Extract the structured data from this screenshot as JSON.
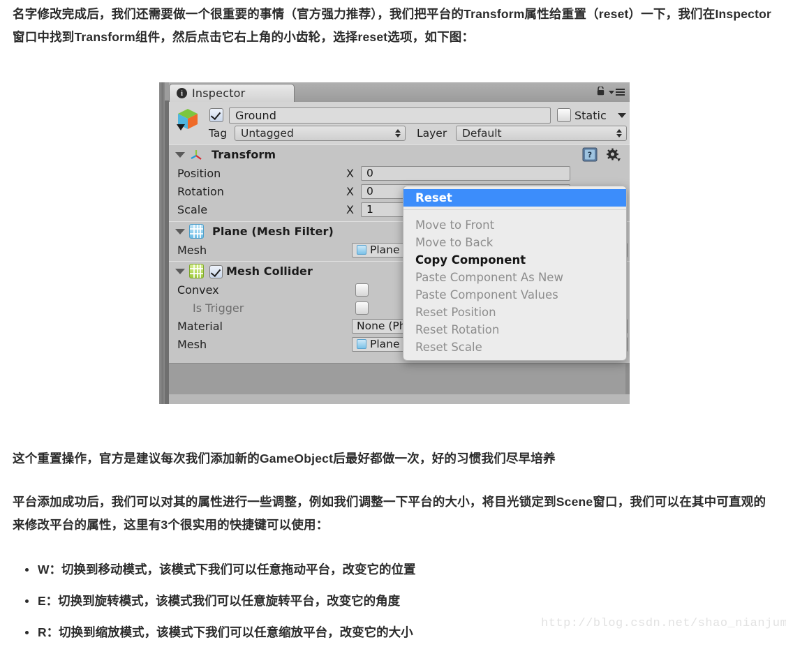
{
  "article": {
    "paragraph_1": "名字修改完成后，我们还需要做一个很重要的事情（官方强力推荐），我们把平台的Transform属性给重置（reset）一下，我们在Inspector窗口中找到Transform组件，然后点击它右上角的小齿轮，选择reset选项，如下图：",
    "paragraph_2": "这个重置操作，官方是建议每次我们添加新的GameObject后最好都做一次，好的习惯我们尽早培养",
    "paragraph_3": "平台添加成功后，我们可以对其的属性进行一些调整，例如我们调整一下平台的大小，将目光锁定到Scene窗口，我们可以在其中可直观的来修改平台的属性，这里有3个很实用的快捷键可以使用：",
    "bullets": [
      "W：切换到移动模式，该模式下我们可以任意拖动平台，改变它的位置",
      "E：切换到旋转模式，该模式我们可以任意旋转平台，改变它的角度",
      "R：切换到缩放模式，该模式下我们可以任意缩放平台，改变它的大小"
    ],
    "watermark": "http://blog.csdn.net/shao_nianjump"
  },
  "inspector": {
    "tab_label": "Inspector",
    "object_name": "Ground",
    "static_label": "Static",
    "tag_label": "Tag",
    "tag_value": "Untagged",
    "layer_label": "Layer",
    "layer_value": "Default",
    "components": [
      {
        "title": "Transform",
        "rows": [
          {
            "label": "Position",
            "axis": "X",
            "value": "0"
          },
          {
            "label": "Rotation",
            "axis": "X",
            "value": "0"
          },
          {
            "label": "Scale",
            "axis": "X",
            "value": "1"
          }
        ]
      },
      {
        "title": "Plane (Mesh Filter)",
        "rows": [
          {
            "label": "Mesh",
            "value": "Plane"
          }
        ]
      },
      {
        "title": "Mesh Collider",
        "rows": [
          {
            "label": "Convex",
            "value": ""
          },
          {
            "label": "Is Trigger",
            "value": ""
          },
          {
            "label": "Material",
            "value": "None (Ph"
          },
          {
            "label": "Mesh",
            "value": "Plane"
          }
        ]
      }
    ]
  },
  "context_menu": {
    "items": [
      {
        "label": "Reset",
        "state": "selected"
      },
      {
        "label": "Move to Front",
        "state": "disabled"
      },
      {
        "label": "Move to Back",
        "state": "disabled"
      },
      {
        "label": "Copy Component",
        "state": "enabled"
      },
      {
        "label": "Paste Component As New",
        "state": "disabled"
      },
      {
        "label": "Paste Component Values",
        "state": "disabled"
      },
      {
        "label": "Reset Position",
        "state": "disabled"
      },
      {
        "label": "Reset Rotation",
        "state": "disabled"
      },
      {
        "label": "Reset Scale",
        "state": "disabled"
      }
    ]
  },
  "colors": {
    "menu_highlight": "#3c8dfb",
    "panel_bg": "#c5c5c5",
    "header_bg": "#d4d4d4"
  }
}
